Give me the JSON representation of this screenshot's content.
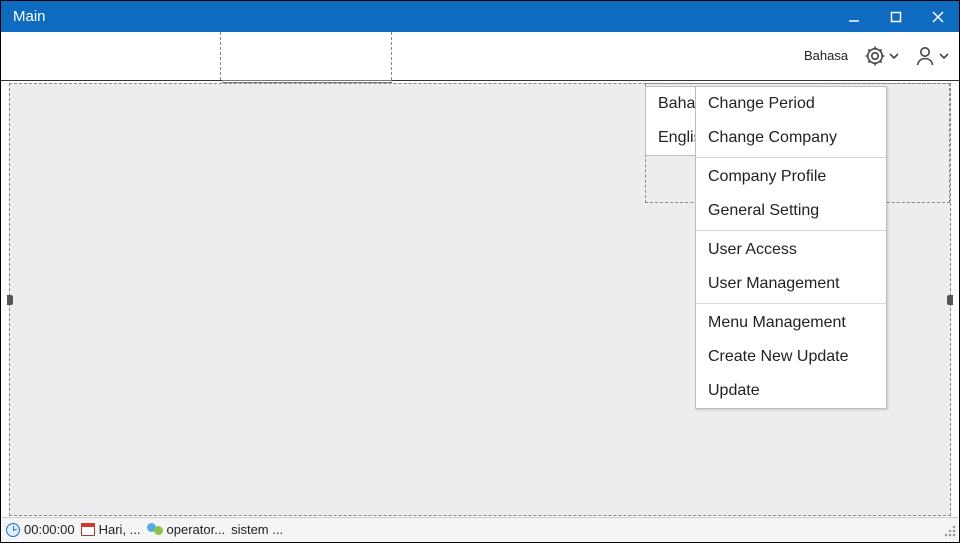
{
  "window": {
    "title": "Main"
  },
  "ribbon": {
    "language_label": "Bahasa"
  },
  "language_menu": {
    "items": [
      "Bahasa",
      "English"
    ]
  },
  "settings_menu": {
    "groups": [
      [
        "Change Period",
        "Change Company"
      ],
      [
        "Company Profile",
        "General Setting"
      ],
      [
        "User Access",
        "User Management"
      ],
      [
        "Menu Management",
        "Create New Update",
        "Update"
      ]
    ]
  },
  "statusbar": {
    "time": "00:00:00",
    "date": "Hari, ...",
    "user": "operator...",
    "system": "sistem ..."
  }
}
